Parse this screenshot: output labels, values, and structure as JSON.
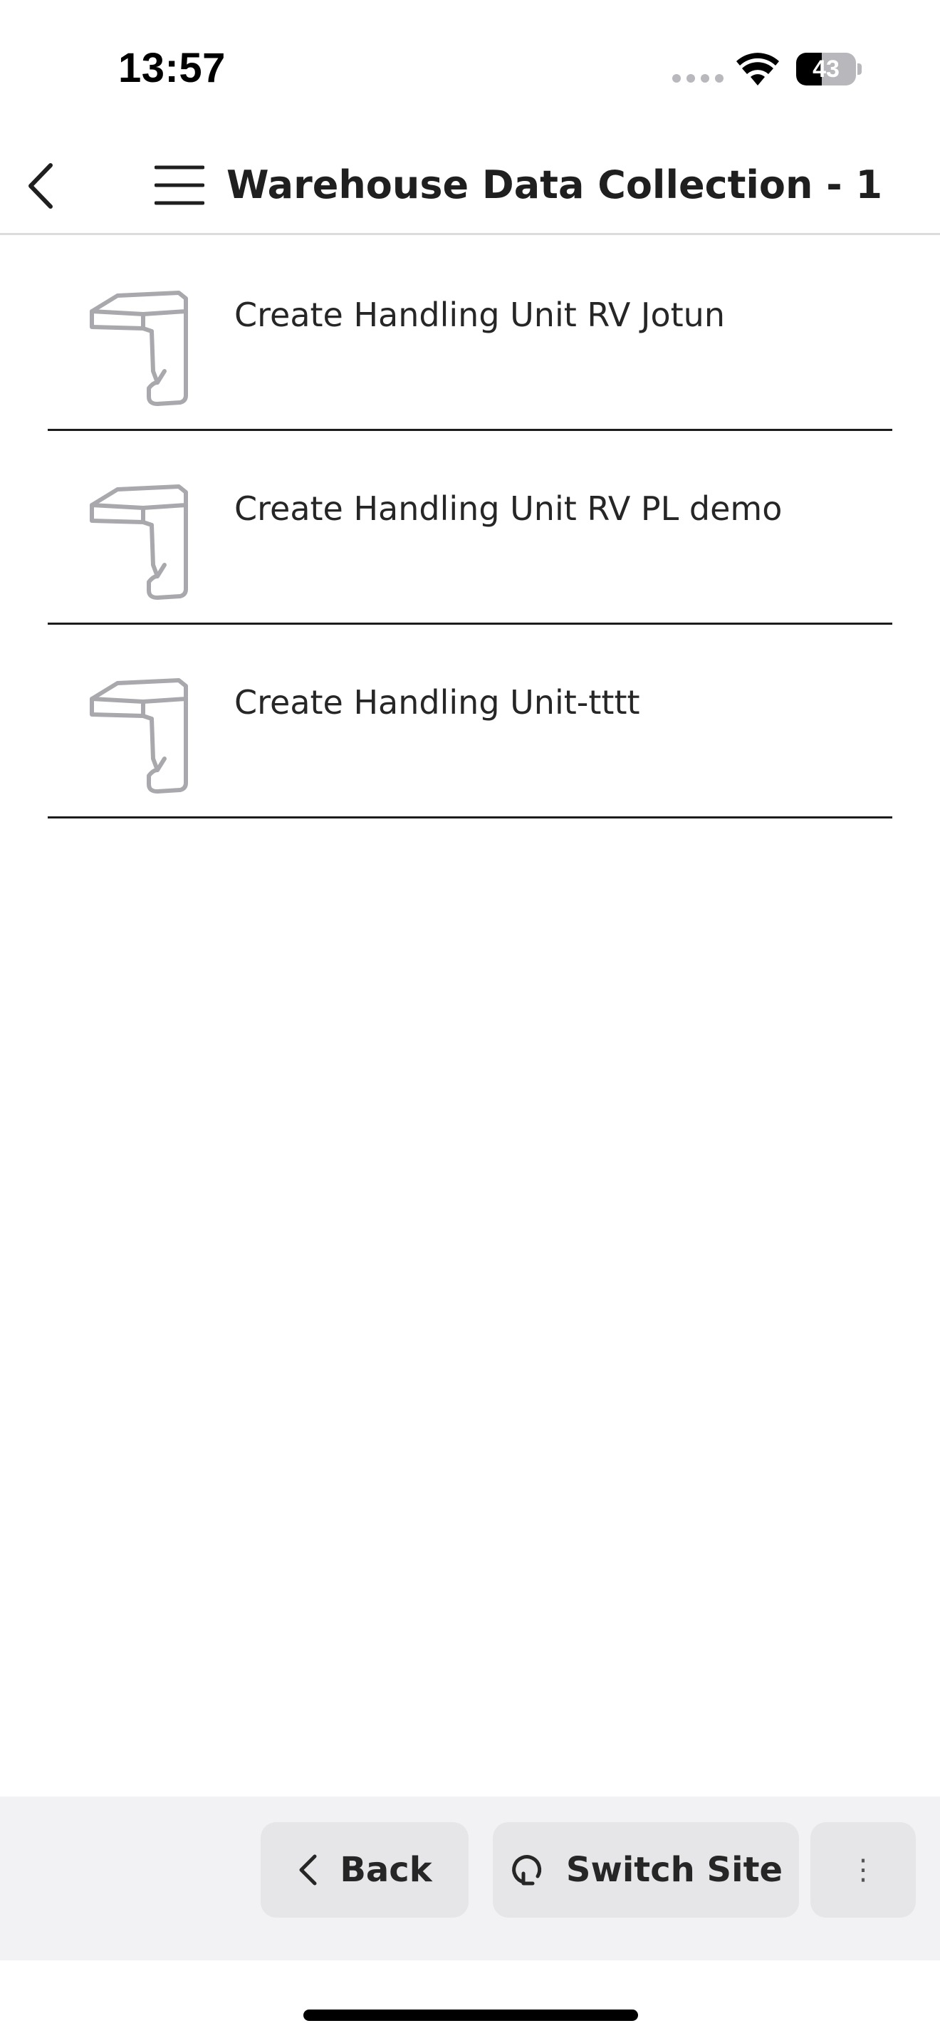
{
  "status_bar": {
    "time": "13:57",
    "battery_level": "43",
    "battery_fraction": 0.43
  },
  "header": {
    "title": "Warehouse Data Collection - 1",
    "back_icon": "chevron-left-icon",
    "menu_icon": "hamburger-menu-icon"
  },
  "list": {
    "item_icon": "barcode-scanner-icon",
    "items": [
      {
        "label": "Create Handling Unit RV Jotun"
      },
      {
        "label": "Create Handling Unit RV PL demo"
      },
      {
        "label": "Create Handling Unit-tttt"
      }
    ]
  },
  "bottom_bar": {
    "back_label": "Back",
    "switch_site_label": "Switch Site",
    "more_glyph": "⋮"
  },
  "colors": {
    "divider": "#1c1c1c",
    "button_bg": "#e6e6e8",
    "bar_bg": "#f2f2f4",
    "icon_gray": "#a9a9ad"
  }
}
